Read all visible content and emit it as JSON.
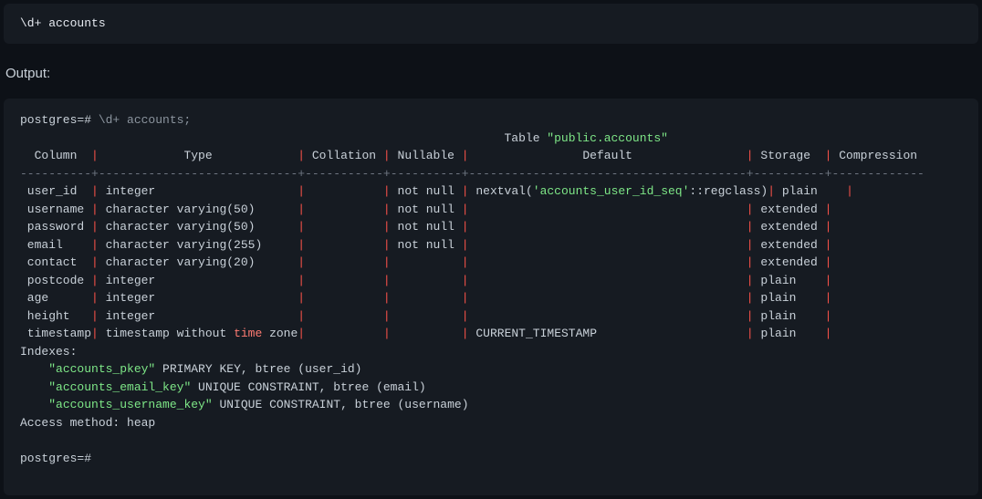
{
  "input_block": "\\d+ accounts",
  "output_label": "Output:",
  "prompt_prefix": "postgres=#",
  "command_echo": " \\d+ accounts;",
  "header_prefix": "Table ",
  "table_name_quoted": "\"public.accounts\"",
  "columns": {
    "col": "Column",
    "type": "Type",
    "collation": "Collation",
    "nullable": "Nullable",
    "def": "Default",
    "storage": "Storage",
    "compression": "Compression"
  },
  "rows": [
    {
      "col": "user_id",
      "type": "integer",
      "collation": "",
      "nullable": "not null",
      "def_pre": "nextval(",
      "def_str": "'accounts_user_id_seq'",
      "def_post": "::regclass)",
      "storage": "plain",
      "compression": ""
    },
    {
      "col": "username",
      "type": "character varying(50)",
      "collation": "",
      "nullable": "not null",
      "def_pre": "",
      "def_str": "",
      "def_post": "",
      "storage": "extended",
      "compression": ""
    },
    {
      "col": "password",
      "type": "character varying(50)",
      "collation": "",
      "nullable": "not null",
      "def_pre": "",
      "def_str": "",
      "def_post": "",
      "storage": "extended",
      "compression": ""
    },
    {
      "col": "email",
      "type": "character varying(255)",
      "collation": "",
      "nullable": "not null",
      "def_pre": "",
      "def_str": "",
      "def_post": "",
      "storage": "extended",
      "compression": ""
    },
    {
      "col": "contact",
      "type": "character varying(20)",
      "collation": "",
      "nullable": "",
      "def_pre": "",
      "def_str": "",
      "def_post": "",
      "storage": "extended",
      "compression": ""
    },
    {
      "col": "postcode",
      "type": "integer",
      "collation": "",
      "nullable": "",
      "def_pre": "",
      "def_str": "",
      "def_post": "",
      "storage": "plain",
      "compression": ""
    },
    {
      "col": "age",
      "type": "integer",
      "collation": "",
      "nullable": "",
      "def_pre": "",
      "def_str": "",
      "def_post": "",
      "storage": "plain",
      "compression": ""
    },
    {
      "col": "height",
      "type": "integer",
      "collation": "",
      "nullable": "",
      "def_pre": "",
      "def_str": "",
      "def_post": "",
      "storage": "plain",
      "compression": ""
    },
    {
      "col": "timestamp",
      "type_pre": "timestamp without ",
      "type_kw": "time",
      "type_post": " zone",
      "collation": "",
      "nullable": "",
      "def_pre": "CURRENT_TIMESTAMP",
      "def_str": "",
      "def_post": "",
      "storage": "plain",
      "compression": ""
    }
  ],
  "indexes_label": "Indexes:",
  "indexes": [
    {
      "name": "\"accounts_pkey\"",
      "rest": " PRIMARY KEY, btree (user_id)"
    },
    {
      "name": "\"accounts_email_key\"",
      "rest": " UNIQUE CONSTRAINT, btree (email)"
    },
    {
      "name": "\"accounts_username_key\"",
      "rest": " UNIQUE CONSTRAINT, btree (username)"
    }
  ],
  "access_method": "Access method: heap",
  "final_prompt": "postgres=#",
  "widths": {
    "col": 10,
    "type": 28,
    "collation": 11,
    "nullable": 10,
    "def": 39,
    "storage": 10,
    "compression": 13
  },
  "header_pad": 68
}
